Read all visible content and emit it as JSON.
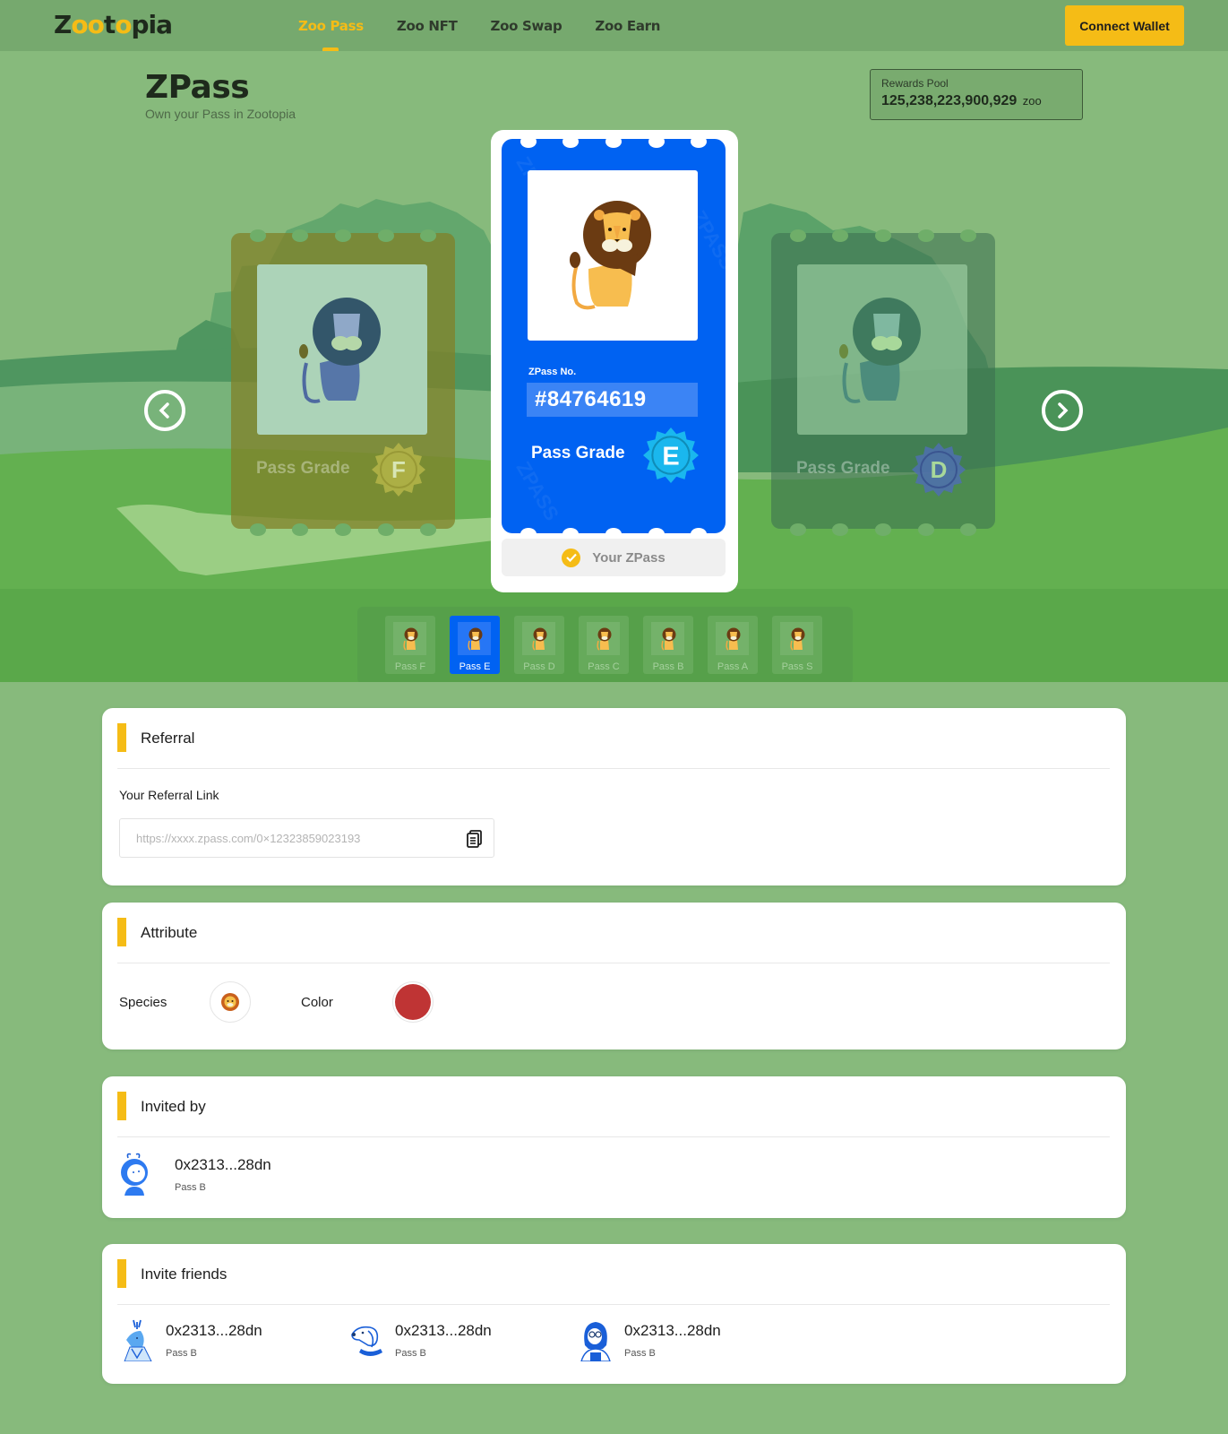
{
  "header": {
    "logo": {
      "parts": [
        "Z",
        "o",
        "o",
        "t",
        "o",
        "pia"
      ]
    },
    "nav": [
      {
        "label": "Zoo Pass",
        "active": true
      },
      {
        "label": "Zoo NFT",
        "active": false
      },
      {
        "label": "Zoo Swap",
        "active": false
      },
      {
        "label": "Zoo Earn",
        "active": false
      }
    ],
    "connect_wallet": "Connect Wallet"
  },
  "hero": {
    "title": "ZPass",
    "subtitle": "Own your Pass in Zootopia",
    "rewards_pool": {
      "label": "Rewards Pool",
      "value": "125,238,223,900,929",
      "unit": "zoo"
    },
    "carousel": {
      "prev_card": {
        "grade_label": "Pass Grade",
        "grade": "F",
        "badge_color": "#b9b84a"
      },
      "current_card": {
        "number_label": "ZPass No.",
        "number": "#84764619",
        "grade_label": "Pass Grade",
        "grade": "E",
        "badge_color": "#1ab7ee",
        "watermark": "ZPASS",
        "status": "Your ZPass"
      },
      "next_card": {
        "grade_label": "Pass Grade",
        "grade": "D",
        "badge_color": "#4f6fb0"
      }
    },
    "pass_tabs": [
      {
        "label": "Pass F",
        "active": false
      },
      {
        "label": "Pass E",
        "active": true
      },
      {
        "label": "Pass D",
        "active": false
      },
      {
        "label": "Pass C",
        "active": false
      },
      {
        "label": "Pass B",
        "active": false
      },
      {
        "label": "Pass A",
        "active": false
      },
      {
        "label": "Pass S",
        "active": false
      }
    ]
  },
  "referral": {
    "title": "Referral",
    "link_label": "Your Referral Link",
    "link_placeholder": "https://xxxx.zpass.com/0×12323859023193"
  },
  "attribute": {
    "title": "Attribute",
    "species_label": "Species",
    "species_icon": "lion-face",
    "color_label": "Color",
    "color_value": "#bf3434"
  },
  "invited_by": {
    "title": "Invited by",
    "user": {
      "address": "0x2313...28dn",
      "pass": "Pass B",
      "avatar": "alien-avatar"
    }
  },
  "invite_friends": {
    "title": "Invite friends",
    "users": [
      {
        "address": "0x2313...28dn",
        "pass": "Pass B",
        "avatar": "deer-avatar"
      },
      {
        "address": "0x2313...28dn",
        "pass": "Pass B",
        "avatar": "dog-avatar"
      },
      {
        "address": "0x2313...28dn",
        "pass": "Pass B",
        "avatar": "girl-avatar"
      }
    ]
  },
  "colors": {
    "accent": "#f5bc16",
    "primary_blue": "#0062f2",
    "page_bg": "#87ba7c",
    "header_bg": "#76a96e"
  }
}
